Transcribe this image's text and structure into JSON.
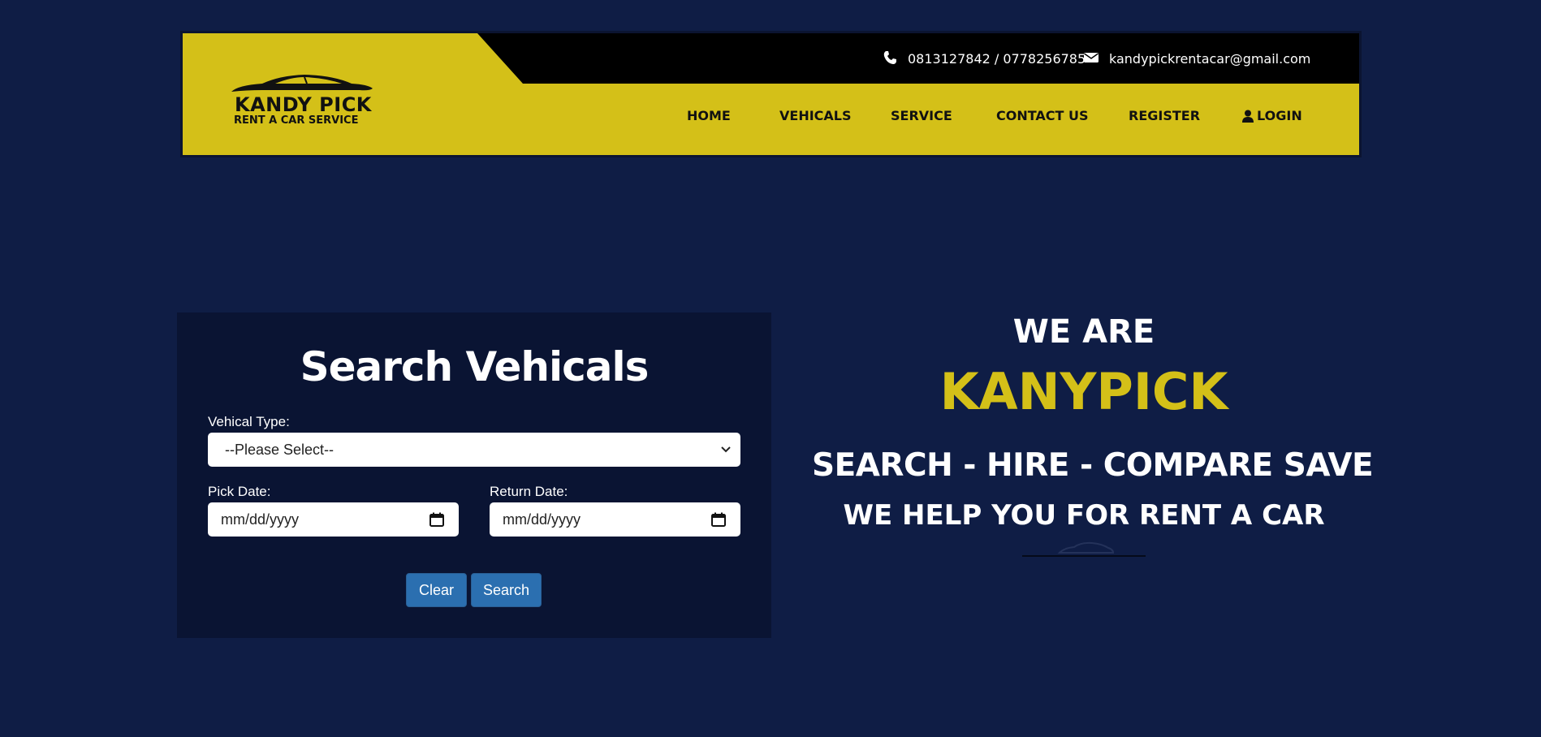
{
  "header": {
    "brand_title": "KANDY PICK",
    "brand_subtitle": "RENT A CAR SERVICE",
    "phone": "0813127842 / 0778256785",
    "email": "kandypickrentacar@gmail.com",
    "nav": [
      {
        "label": "HOME"
      },
      {
        "label": "VEHICALS"
      },
      {
        "label": "SERVICE"
      },
      {
        "label": "CONTACT US"
      },
      {
        "label": "REGISTER"
      },
      {
        "label": "LOGIN",
        "icon": "user-icon"
      }
    ]
  },
  "search": {
    "title": "Search Vehicals",
    "type_label": "Vehical Type:",
    "type_value": "--Please Select--",
    "pick_label": "Pick Date:",
    "pick_value": "mm/dd/yyyy",
    "return_label": "Return Date:",
    "return_value": "mm/dd/yyyy",
    "clear_label": "Clear",
    "search_label": "Search"
  },
  "hero": {
    "line1": "WE ARE",
    "brand": "KANYPICK",
    "line3": "SEARCH - HIRE - COMPARE SAVE",
    "line4": "WE HELP YOU FOR RENT A CAR"
  },
  "colors": {
    "page_bg": "#0f1d45",
    "header_yellow": "#d4c018",
    "panel_bg": "#0a1433",
    "button_blue": "#2b6fb0",
    "brand_yellow": "#d4c018"
  },
  "icons": [
    "phone-icon",
    "envelope-icon",
    "user-icon",
    "calendar-icon",
    "chevron-down-icon",
    "car-logo-icon"
  ]
}
